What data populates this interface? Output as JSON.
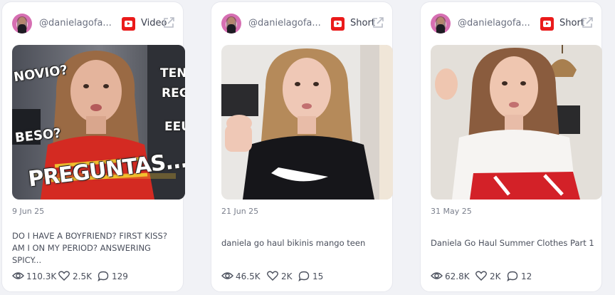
{
  "cards": [
    {
      "handle": "@danielagofa...",
      "type": "Video",
      "date": "9 Jun 25",
      "title": "DO I HAVE A BOYFRIEND? FIRST KISS? AM I ON MY PERIOD? ANSWERING SPICY...",
      "views": "110.3K",
      "likes": "2.5K",
      "comments": "129",
      "thumb_text": {
        "main": "PREGUNTAS...",
        "novio": "NOVIO?",
        "beso": "BESO?",
        "right1": "TENG",
        "right2": "REGI",
        "right3": "EEU"
      }
    },
    {
      "handle": "@danielagofa...",
      "type": "Short",
      "date": "21 Jun 25",
      "title": "daniela go haul bikinis mango teen",
      "views": "46.5K",
      "likes": "2K",
      "comments": "15"
    },
    {
      "handle": "@danielagofa...",
      "type": "Short",
      "date": "31 May 25",
      "title": "Daniela Go Haul Summer Clothes Part 1",
      "views": "62.8K",
      "likes": "2K",
      "comments": "12"
    }
  ],
  "icons": {
    "platform": "youtube-icon",
    "external": "external-link-icon",
    "views": "eye-icon",
    "likes": "heart-icon",
    "comments": "comment-icon"
  },
  "colors": {
    "youtube_red": "#ea1b1b",
    "card_bg": "#ffffff",
    "page_bg": "#f1f2f6"
  }
}
